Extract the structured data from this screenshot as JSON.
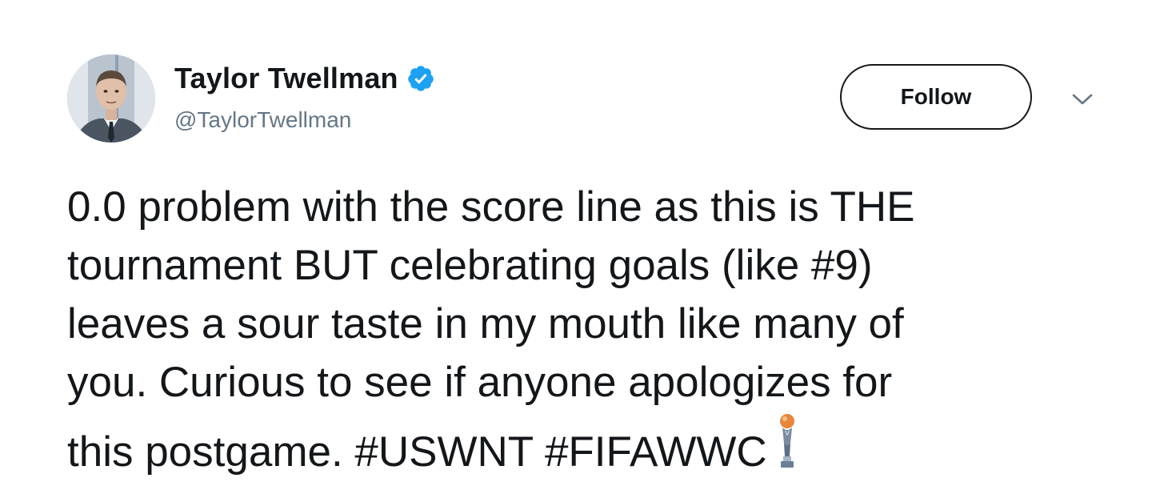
{
  "tweet": {
    "author": {
      "display_name": "Taylor Twellman",
      "handle": "@TaylorTwellman",
      "verified": true,
      "avatar_icon": "avatar"
    },
    "follow_label": "Follow",
    "menu_icon": "chevron-down-icon",
    "text_lines": [
      "0.0 problem with the score line as this is THE",
      "tournament BUT celebrating goals (like #9)",
      "leaves a sour taste in my mouth like many of",
      "you. Curious to see if anyone apologizes for",
      "this postgame. #USWNT #FIFAWWC"
    ],
    "emoji_icon": "trophy-icon"
  },
  "colors": {
    "text": "#14171a",
    "secondary_text": "#657786",
    "verified_blue": "#1da1f2",
    "background": "#ffffff"
  }
}
